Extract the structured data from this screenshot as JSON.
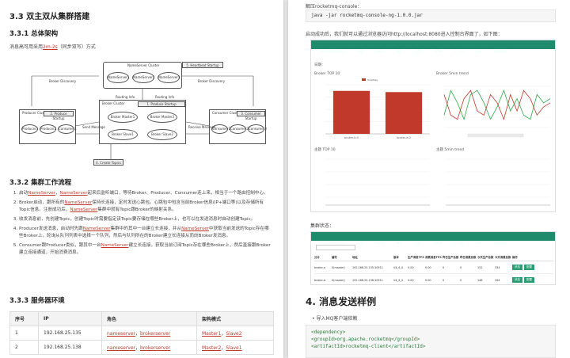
{
  "left": {
    "heading": "3.3 双主双从集群搭建",
    "s1": "3.3.1 总体架构",
    "s1_text_pre": "消息高可用采用",
    "s1_text_link": "2m-2s",
    "s1_text_post": "（同步双写）方式",
    "diagram": {
      "nameserver_cluster": "NameServer Cluster",
      "ns": [
        "NameServer1",
        "NameServer2",
        "NameServer3"
      ],
      "heartbeat_master": "5. Heartbeat Startup",
      "broker_cluster": "Broker Cluster",
      "brokers": [
        "Broker Master1",
        "Broker Master2",
        "Broker Slave1",
        "Broker Slave2"
      ],
      "producer_cluster": "Producer Cluster",
      "producers": [
        "Producer1",
        "Producer2",
        "Consumer1"
      ],
      "consumer_cluster": "Consumer Cluster",
      "consumers": [
        "Consumer1",
        "Consumer2",
        "Consumer3"
      ],
      "labels": [
        "1. Produce Startup",
        "2. Produce Startup",
        "3. Consumer Startup",
        "Broker Discovery",
        "Broker Discovery",
        "Send Message",
        "Receive Message",
        "4. Create Topics",
        "Routing Info",
        "Routing Info"
      ]
    },
    "s2": "3.3.2 集群工作流程",
    "flow": [
      [
        "启动",
        "NameServer",
        "，",
        "NameServer",
        "起来后监听端口，等待Broker、Producer、Consumer连上来，相当于一个路由控制中心。"
      ],
      [
        "Broker启动，跟所有的",
        "NameServer",
        "保持长连接，定时发送心跳包。心跳包中包含当前Broker信息(IP+端口等)以及存储所有Topic信息。注册成功后，",
        "NameServer",
        "集群中就有Topic跟Broker的映射关系。"
      ],
      [
        "收发消息前，先创建Topic，创建Topic时需要指定该Topic要存储在哪些Broker上，也可以在发送消息时自动创建Topic。",
        "",
        "",
        "",
        ""
      ],
      [
        "Producer发送消息，启动时先跟",
        "NameServer",
        "集群中的其中一台建立长连接，并从",
        "NameServer",
        "中获取当前发送的Topic存在哪些Broker上，轮询从队列列表中选择一个队列，然后与队列所在的Broker建立长连接从而向Broker发消息。"
      ],
      [
        "Consumer跟Producer类似，跟其中一台",
        "NameServer",
        "建立长连接，获取当前订阅Topic存在哪些Broker上，然后直接跟Broker建立连接通道，开始消费消息。",
        "",
        ""
      ]
    ],
    "s3": "3.3.3 服务器环境",
    "env_headers": [
      "序号",
      "IP",
      "角色",
      "架构模式"
    ],
    "env_rows": [
      {
        "no": "1",
        "ip": "192.168.25.135",
        "role1": "nameserver",
        "role2": "brokerserver",
        "mode1": "Master1",
        "mode2": "Slave2"
      },
      {
        "no": "2",
        "ip": "192.168.25.138",
        "role1": "nameserver",
        "role2": "brokerserver",
        "mode1": "Master2",
        "mode2": "Slave1"
      }
    ]
  },
  "right": {
    "top_text": "解压rocketmq-console：",
    "cmd": "java -jar rocketmq-console-ng-1.0.0.jar",
    "after_text": "启动成功后，我们就可以通过浏览器访问http://localhost:8080进入控制台界面了，如下图：",
    "nav_items": [
      "RocketMQ控制台",
      "运维",
      "驾驶舱",
      "集群",
      "主题",
      "消费者",
      "生产者",
      "消息",
      "消息轨迹"
    ],
    "panel1_title": "Broker TOP 10",
    "panel2_title": "Broker 5min trend",
    "panel3_title": "主题 TOP 10",
    "panel4_title": "主题 5min trend",
    "legend_total": "TotalMsg",
    "bar_categories": [
      "broker-b:0",
      "broker-a:0"
    ],
    "date_label": "日期：",
    "cluster_label": "集群状态：",
    "table_headers": [
      "分片",
      "编号",
      "地址",
      "版本",
      "生产消息TPS",
      "消费消息TPS",
      "昨日生产总数",
      "昨日消费总数",
      "今天生产总数",
      "今天消费总数",
      "操作"
    ],
    "table_rows": [
      [
        "broker-a",
        "0(master)",
        "192.168.25.135:10911",
        "V4_4_0",
        "0.00",
        "0.00",
        "0",
        "0",
        "152",
        "334"
      ],
      [
        "broker-b",
        "0(master)",
        "192.168.25.138:10911",
        "V4_4_0",
        "0.00",
        "0.00",
        "0",
        "0",
        "148",
        "344"
      ]
    ],
    "btn_status": "状态",
    "btn_config": "配置",
    "heading4": "4. 消息发送样例",
    "bullet": "导入MQ客户端依赖",
    "code_lines": [
      "<dependency>",
      "    <groupId>org.apache.rocketmq</groupId>",
      "    <artifactId>rocketmq-client</artifactId>"
    ]
  },
  "chart_data": [
    {
      "type": "bar",
      "title": "Broker TOP 10",
      "categories": [
        "broker-b:0",
        "broker-a:0"
      ],
      "series": [
        {
          "name": "TotalMsg",
          "values": [
            175,
            170
          ]
        }
      ],
      "ylim": [
        0,
        200
      ]
    },
    {
      "type": "line",
      "title": "Broker 5min trend",
      "x": [
        0,
        1,
        2,
        3,
        4,
        5,
        6,
        7,
        8,
        9,
        10,
        11,
        12,
        13,
        14,
        15,
        16
      ],
      "series": [
        {
          "values": [
            3,
            9,
            6,
            2,
            8,
            9,
            6,
            2,
            5,
            9,
            4,
            7,
            3,
            2,
            8,
            6,
            7
          ]
        },
        {
          "values": [
            8,
            3,
            2,
            7,
            9,
            4,
            3,
            8,
            6,
            2,
            8,
            4,
            9,
            7,
            3,
            5,
            6
          ]
        }
      ],
      "ylim": [
        0,
        10
      ]
    }
  ]
}
